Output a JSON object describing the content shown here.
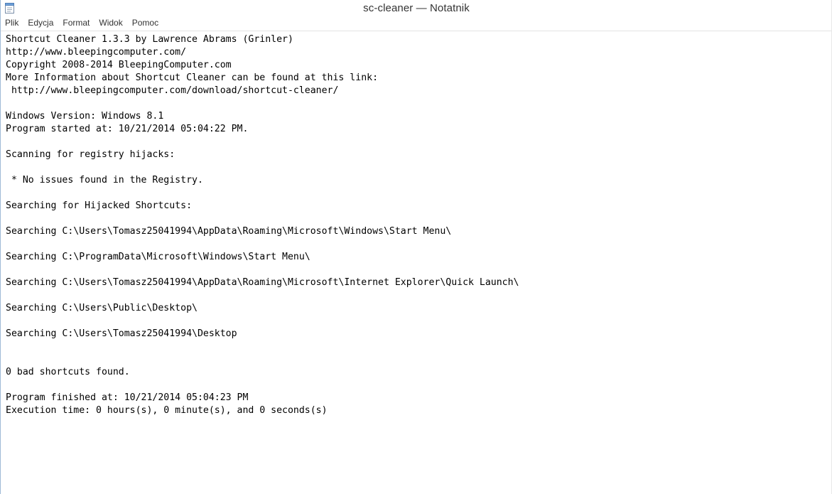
{
  "window": {
    "title": "sc-cleaner — Notatnik",
    "app_icon": "notepad-icon"
  },
  "menu": {
    "items": [
      "Plik",
      "Edycja",
      "Format",
      "Widok",
      "Pomoc"
    ]
  },
  "editor": {
    "lines": [
      "Shortcut Cleaner 1.3.3 by Lawrence Abrams (Grinler)",
      "http://www.bleepingcomputer.com/",
      "Copyright 2008-2014 BleepingComputer.com",
      "More Information about Shortcut Cleaner can be found at this link:",
      " http://www.bleepingcomputer.com/download/shortcut-cleaner/",
      "",
      "Windows Version: Windows 8.1",
      "Program started at: 10/21/2014 05:04:22 PM.",
      "",
      "Scanning for registry hijacks:",
      "",
      " * No issues found in the Registry.",
      "",
      "Searching for Hijacked Shortcuts:",
      "",
      "Searching C:\\Users\\Tomasz25041994\\AppData\\Roaming\\Microsoft\\Windows\\Start Menu\\",
      "",
      "Searching C:\\ProgramData\\Microsoft\\Windows\\Start Menu\\",
      "",
      "Searching C:\\Users\\Tomasz25041994\\AppData\\Roaming\\Microsoft\\Internet Explorer\\Quick Launch\\",
      "",
      "Searching C:\\Users\\Public\\Desktop\\",
      "",
      "Searching C:\\Users\\Tomasz25041994\\Desktop",
      "",
      "",
      "0 bad shortcuts found.",
      "",
      "Program finished at: 10/21/2014 05:04:23 PM",
      "Execution time: 0 hours(s), 0 minute(s), and 0 seconds(s)"
    ]
  }
}
